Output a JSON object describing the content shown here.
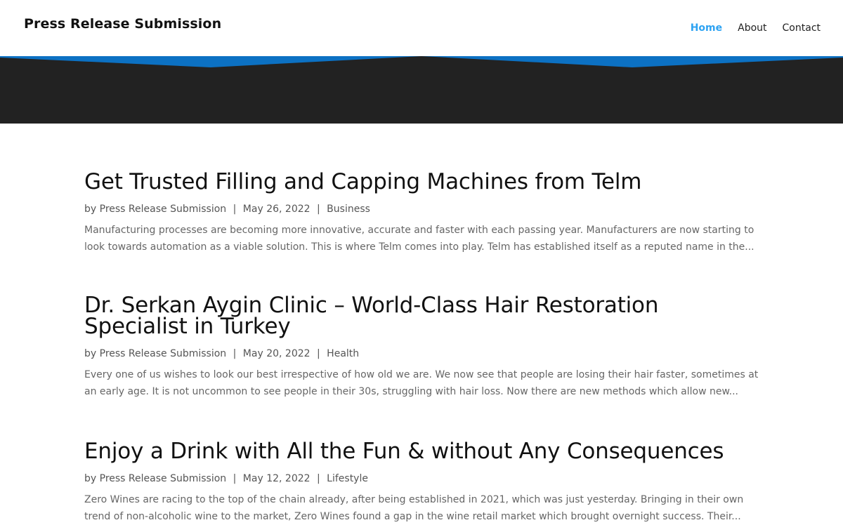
{
  "header": {
    "site_title": "Press Release Submission",
    "nav": [
      {
        "label": "Home",
        "active": true
      },
      {
        "label": "About",
        "active": false
      },
      {
        "label": "Contact",
        "active": false
      }
    ]
  },
  "colors": {
    "accent": "#2ea3f2",
    "banner_dark": "#222222",
    "banner_blue": "#0c71c3"
  },
  "posts": [
    {
      "title": "Get Trusted Filling and Capping Machines from Telm",
      "meta_prefix": "by",
      "author": "Press Release Submission",
      "separator": "|",
      "date": "May 26, 2022",
      "category": "Business",
      "excerpt": "Manufacturing processes are becoming more innovative, accurate and faster with each passing year. Manufacturers are now starting to look towards automation as a viable solution. This is where Telm comes into play. Telm has established itself as a reputed name in the..."
    },
    {
      "title": "Dr. Serkan Aygin Clinic – World-Class Hair Restoration Specialist in Turkey",
      "meta_prefix": "by",
      "author": "Press Release Submission",
      "separator": "|",
      "date": "May 20, 2022",
      "category": "Health",
      "excerpt": "Every one of us wishes to look our best irrespective of how old we are. We now see that people are losing their hair faster, sometimes at an early age. It is not uncommon to see people in their 30s, struggling with hair loss. Now there are new methods which allow new..."
    },
    {
      "title": "Enjoy a Drink with All the Fun & without Any Consequences",
      "meta_prefix": "by",
      "author": "Press Release Submission",
      "separator": "|",
      "date": "May 12, 2022",
      "category": "Lifestyle",
      "excerpt": "Zero Wines are racing to the top of the chain already, after being established in 2021, which was just yesterday. Bringing in their own trend of non-alcoholic wine to the market, Zero Wines found a gap in the wine retail market which brought overnight success. Their..."
    }
  ]
}
